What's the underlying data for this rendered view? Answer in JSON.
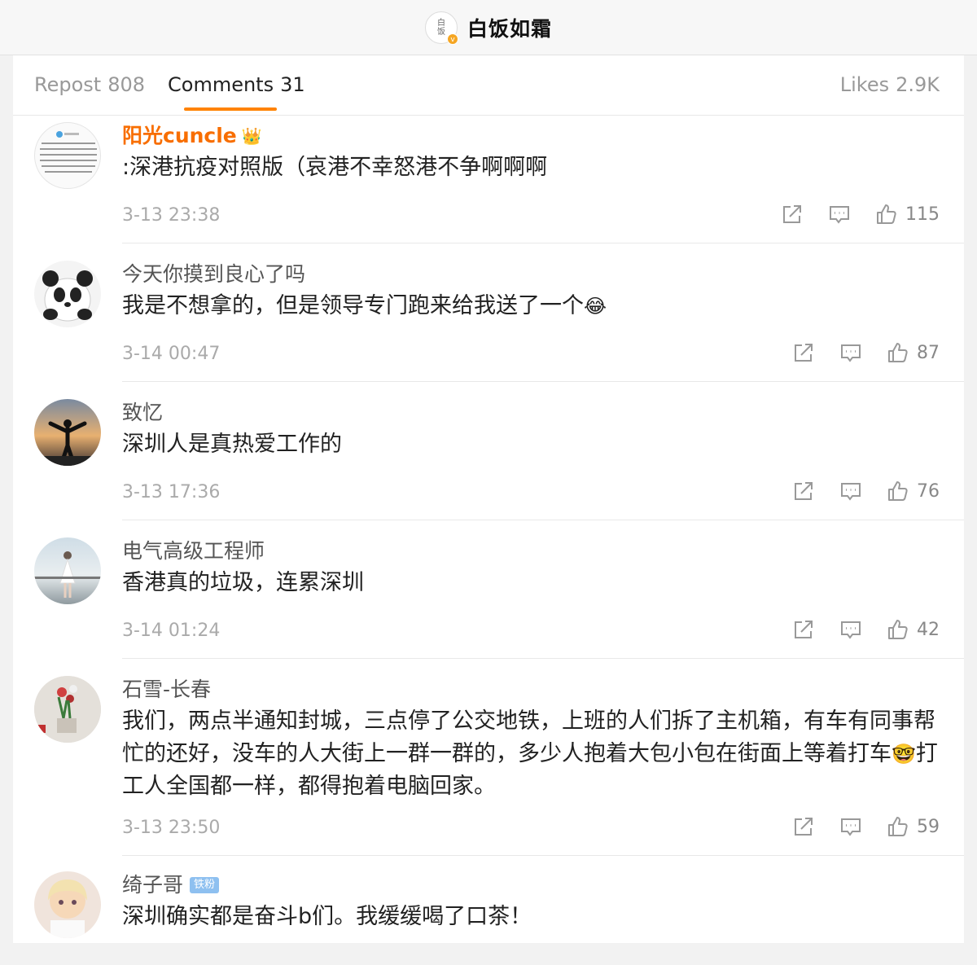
{
  "header": {
    "title": "白饭如霜",
    "avatar_text": "白\n饭",
    "badge": "v"
  },
  "tabs": {
    "repost_label": "Repost",
    "repost_count": "808",
    "comments_label": "Comments",
    "comments_count": "31",
    "likes_label": "Likes",
    "likes_count": "2.9K"
  },
  "colors": {
    "accent": "#ff8200",
    "vip_name": "#f86e00"
  },
  "comments": [
    {
      "name": "阳光cuncle",
      "vip": true,
      "text": ":深港抗疫对照版（哀港不幸怒港不争啊啊啊",
      "time": "3-13 23:38",
      "likes": "115",
      "emoji": ""
    },
    {
      "name": "今天你摸到良心了吗",
      "vip": false,
      "text": "我是不想拿的，但是领导专门跑来给我送了一个",
      "time": "3-14 00:47",
      "likes": "87",
      "emoji": "😂"
    },
    {
      "name": "致忆",
      "vip": false,
      "text": "深圳人是真热爱工作的",
      "time": "3-13 17:36",
      "likes": "76",
      "emoji": ""
    },
    {
      "name": "电气高级工程师",
      "vip": false,
      "text": "香港真的垃圾，连累深圳",
      "time": "3-14 01:24",
      "likes": "42",
      "emoji": ""
    },
    {
      "name": "石雪-长春",
      "vip": false,
      "text_1": "我们，两点半通知封城，三点停了公交地铁，上班的人们拆了主机箱，有车有同事帮忙的还好，没车的人大街上一群一群的，多少人抱着大包小包在街面上等着打车",
      "emoji": "🤓",
      "text_2": "打工人全国都一样，都得抱着电脑回家。",
      "time": "3-13 23:50",
      "likes": "59"
    },
    {
      "name": "绮子哥",
      "vip": false,
      "badge": "铁粉",
      "text": "深圳确实都是奋斗b们。我缓缓喝了口茶！"
    }
  ]
}
